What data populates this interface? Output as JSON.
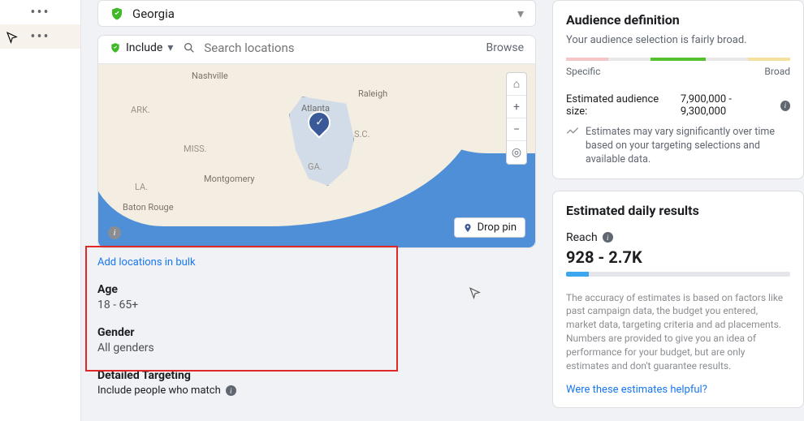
{
  "location": {
    "selected": "Georgia",
    "include_label": "Include",
    "search_placeholder": "Search locations",
    "browse_label": "Browse",
    "bulk_link": "Add locations in bulk",
    "drop_pin": "Drop pin",
    "map_labels": {
      "nashville": "Nashville",
      "raleigh": "Raleigh",
      "ark": "ARK.",
      "miss": "MISS.",
      "sc": "S.C.",
      "la": "LA.",
      "montgomery": "Montgomery",
      "ga": "GA.",
      "baton_rouge": "Baton Rouge",
      "atlanta": "Atlanta"
    }
  },
  "age": {
    "heading": "Age",
    "value": "18 - 65+"
  },
  "gender": {
    "heading": "Gender",
    "value": "All genders"
  },
  "detailed": {
    "heading": "Detailed Targeting",
    "sub": "Include people who match"
  },
  "audience": {
    "title": "Audience definition",
    "sub": "Your audience selection is fairly broad.",
    "spec": "Specific",
    "broad": "Broad",
    "est_label": "Estimated audience size:",
    "est_value": "7,900,000 - 9,300,000",
    "warn": "Estimates may vary significantly over time based on your targeting selections and available data."
  },
  "results": {
    "title": "Estimated daily results",
    "reach_label": "Reach",
    "reach_value": "928 - 2.7K",
    "disclaimer": "The accuracy of estimates is based on factors like past campaign data, the budget you entered, market data, targeting criteria and ad placements. Numbers are provided to give you an idea of performance for your budget, but are only estimates and don't guarantee results.",
    "helpful": "Were these estimates helpful?"
  }
}
